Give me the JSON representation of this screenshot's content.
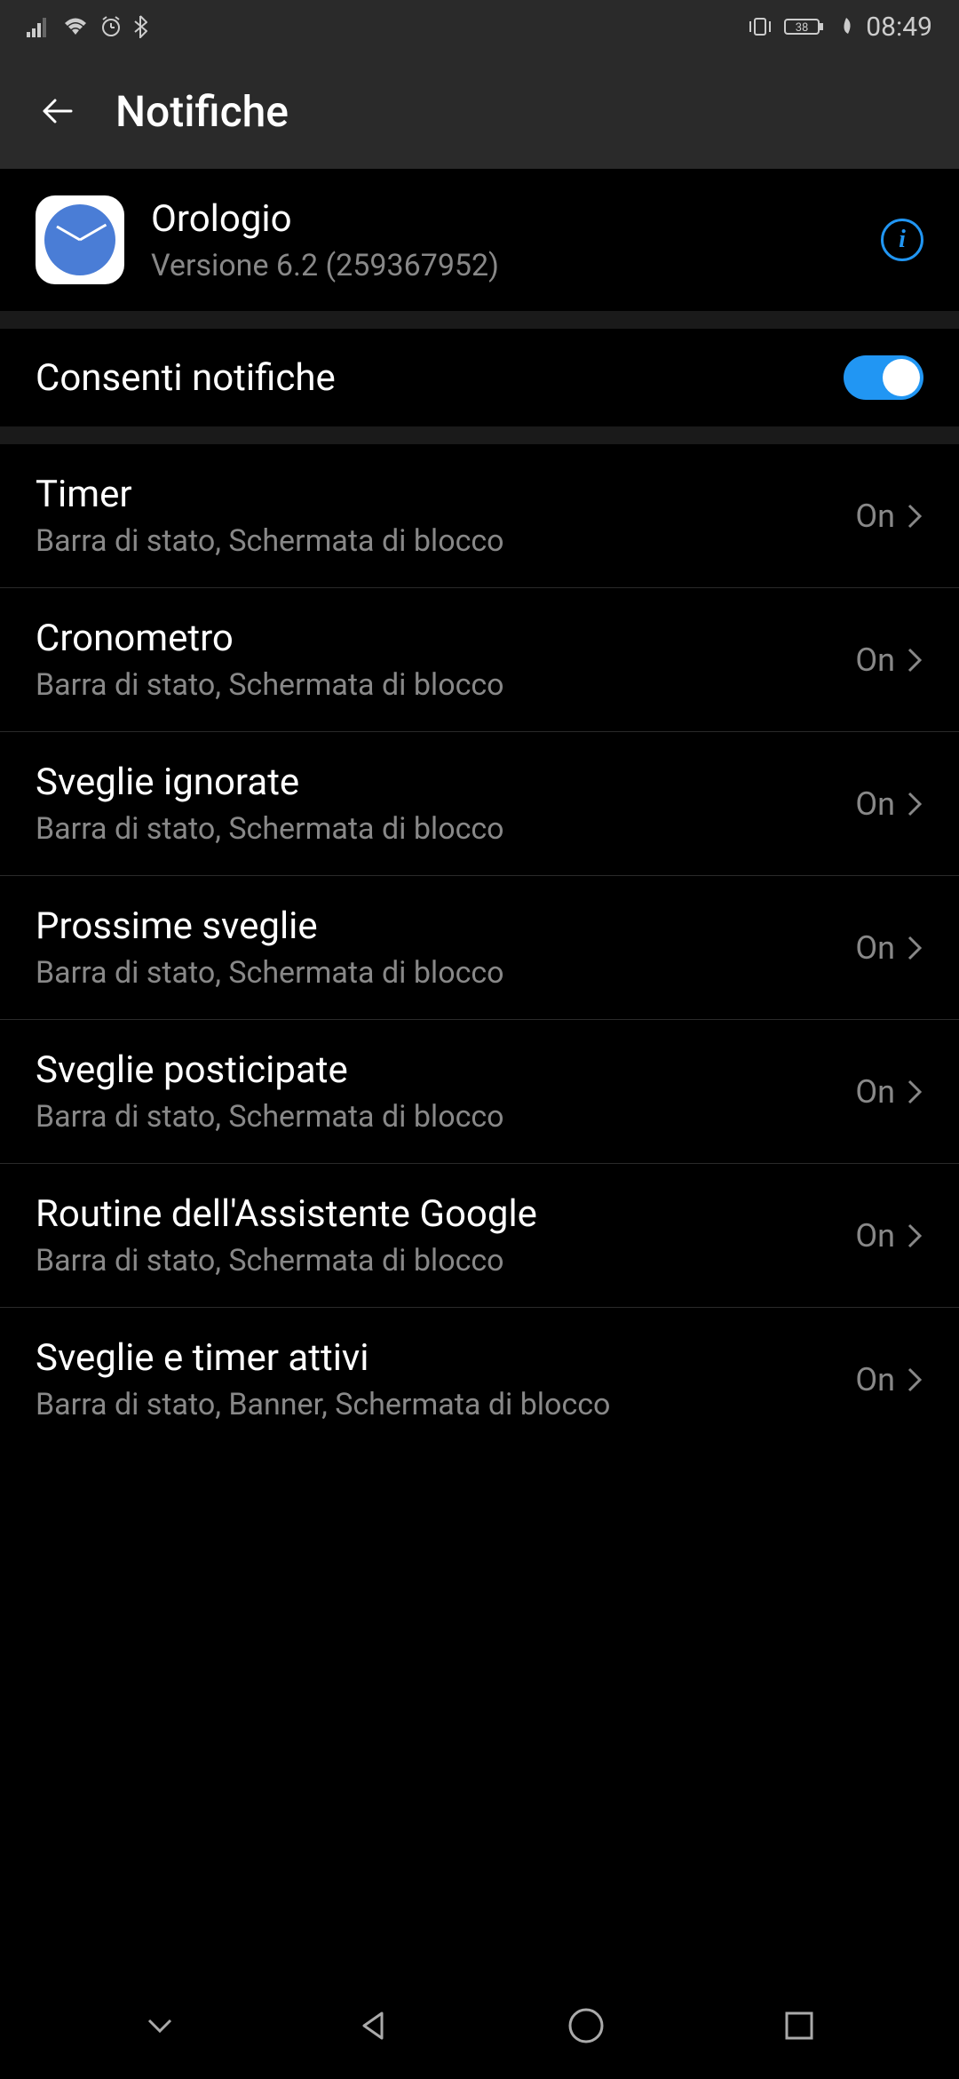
{
  "status": {
    "battery": "38",
    "time": "08:49"
  },
  "header": {
    "title": "Notifiche"
  },
  "app": {
    "name": "Orologio",
    "version": "Versione 6.2 (259367952)"
  },
  "allow_notifications": {
    "label": "Consenti notifiche",
    "enabled": true
  },
  "categories": [
    {
      "title": "Timer",
      "subtitle": "Barra di stato, Schermata di blocco",
      "value": "On"
    },
    {
      "title": "Cronometro",
      "subtitle": "Barra di stato, Schermata di blocco",
      "value": "On"
    },
    {
      "title": "Sveglie ignorate",
      "subtitle": "Barra di stato, Schermata di blocco",
      "value": "On"
    },
    {
      "title": "Prossime sveglie",
      "subtitle": "Barra di stato, Schermata di blocco",
      "value": "On"
    },
    {
      "title": "Sveglie posticipate",
      "subtitle": "Barra di stato, Schermata di blocco",
      "value": "On"
    },
    {
      "title": "Routine dell'Assistente Google",
      "subtitle": "Barra di stato, Schermata di blocco",
      "value": "On"
    },
    {
      "title": "Sveglie e timer attivi",
      "subtitle": "Barra di stato, Banner, Schermata di blocco",
      "value": "On"
    }
  ]
}
